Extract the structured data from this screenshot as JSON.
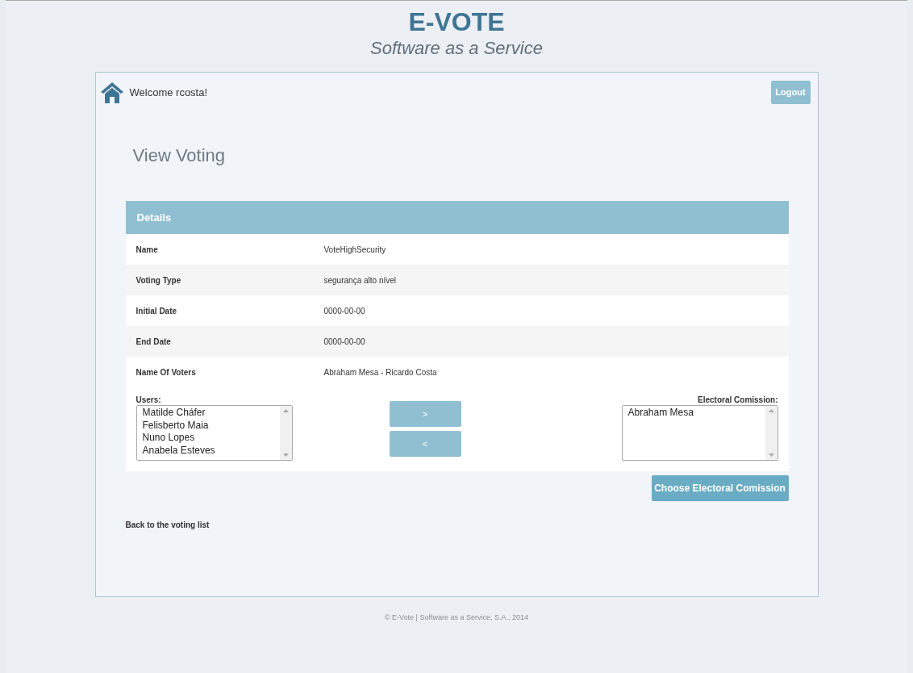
{
  "header": {
    "title": "E-VOTE",
    "subtitle": "Software as a Service"
  },
  "top_bar": {
    "welcome": "Welcome rcosta!",
    "logout": "Logout"
  },
  "page_title": "View Voting",
  "details": {
    "heading": "Details",
    "rows": [
      {
        "label": "Name",
        "value": "VoteHighSecurity"
      },
      {
        "label": "Voting Type",
        "value": "segurança alto nível"
      },
      {
        "label": "Initial Date",
        "value": "0000-00-00"
      },
      {
        "label": "End Date",
        "value": "0000-00-00"
      },
      {
        "label": "Name Of Voters",
        "value": "Abraham Mesa - Ricardo Costa"
      }
    ]
  },
  "users": {
    "label": "Users:",
    "items": [
      "Matilde Cháfer",
      "Felisberto Maia",
      "Nuno Lopes",
      "Anabela Esteves"
    ]
  },
  "move_buttons": [
    ">",
    "<"
  ],
  "commission": {
    "label": "Electoral Comission:",
    "items": [
      "Abraham Mesa"
    ]
  },
  "choose_button": "Choose Electoral Comission",
  "back_link": "Back to the voting list",
  "footer": "© E-Vote | Software as a Service, S.A., 2014"
}
